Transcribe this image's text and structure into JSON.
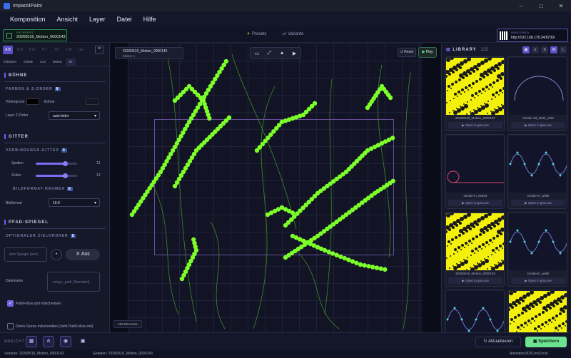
{
  "window": {
    "title": "Impact4Paint",
    "minimize": "–",
    "maximize": "□",
    "close": "✕"
  },
  "menu": [
    "Komposition",
    "Ansicht",
    "Layer",
    "Datei",
    "Hilfe"
  ],
  "topbar": {
    "path_label": "PATHSPEC",
    "path_value": "20260516_Motion_0000143",
    "presets": "Presets",
    "variante": "Variante",
    "url_label": "REMOTEBOX",
    "url_value": "http://192.168.178.34:8730/"
  },
  "left": {
    "tabs": [
      "A B",
      "D E",
      "F G",
      "H I",
      "J K",
      "L M",
      "Lev"
    ],
    "subtabs": [
      "Schwarm",
      "Schale",
      "Loci",
      "Motion",
      "Bi"
    ],
    "sec_buehne": "BÜHNE",
    "sub_farben": "FARBEN & Z-ORDER",
    "sub_farben_n": "8",
    "hintergrund": "Hintergrund",
    "buehne_label": "Bühne",
    "layer_z": "Layer Z-Order",
    "layer_z_value": "auto-letter",
    "sec_gitter": "GITTER",
    "sub_verb": "VERBINDUNGS-GITTER",
    "sub_verb_n": "8",
    "spalten": "Spalten",
    "spalten_value": "12",
    "spalten_pct": 72,
    "zeilen": "Zeilen",
    "zeilen_value": "12",
    "zeilen_pct": 72,
    "sub_bild": "BILDFORMAT-RAHMEN",
    "sub_bild_n": "8",
    "bildformat": "Bildformat",
    "bildformat_value": "16:9",
    "sec_pfad": "PFAD-SPIEGEL",
    "sub_opt": "OPTIONALER ZIELORDNER",
    "sub_opt_n": "8",
    "spiegel_placeholder": "kein Spiegel (leer)",
    "aus": "Aus",
    "dateiname": "Dateiname",
    "dateiname_placeholder": "<slug>_path (Standard)",
    "pathfollow": "PathFollow.qml mitschreiben",
    "demo": "Demo-Szene mitschreiben (zieht PathFollow mit)"
  },
  "canvas": {
    "layer_name": "20260516_Motion_0000143",
    "layer_sub": "Ebene A",
    "reset": "Reset",
    "play": "Play",
    "count": "480 Elemente"
  },
  "library": {
    "title": "LIBRARY",
    "count": "222",
    "sizes": [
      "S",
      "M",
      "L"
    ],
    "cards": [
      {
        "name": "20260516_Motion_0000157",
        "open": "Open in gmLove",
        "kind": "yellow"
      },
      {
        "name": "smoke-3d_kette_orbit",
        "open": "Open in gmLove",
        "kind": "arc"
      },
      {
        "name": "smoke-in_kette3",
        "open": "Open in gmLove",
        "kind": "pendel"
      },
      {
        "name": "smoke-in_welle",
        "open": "Open in gmLove",
        "kind": "wave"
      },
      {
        "name": "20260516_Motion_0000153",
        "open": "Open in gmLove",
        "kind": "yellow"
      },
      {
        "name": "smoke-in_welle",
        "open": "Open in gmLove",
        "kind": "wave"
      },
      {
        "name": "",
        "open": "",
        "kind": "wave"
      },
      {
        "name": "",
        "open": "",
        "kind": "yellow"
      }
    ]
  },
  "bottom": {
    "ansicht": "ANSICHT",
    "aktualisieren": "Aktualisieren",
    "speichern": "Speichern"
  },
  "status": {
    "variante": "Variante: 20260516_Motion_0000143",
    "geladen": "Geladen: 20260516_Motion_0000143",
    "right": "Animation3D/CoreCircle"
  },
  "colors": {
    "accent": "#5b52c9",
    "curve": "#7dff2a",
    "save": "#6de38f",
    "yellow": "#f3f00c"
  }
}
